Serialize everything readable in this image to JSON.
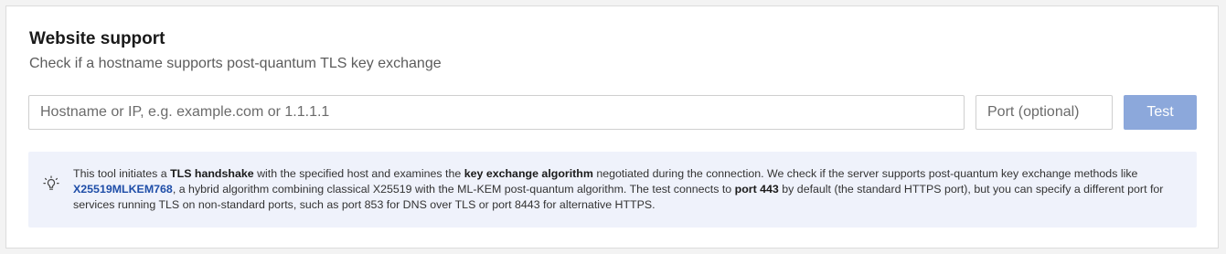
{
  "section": {
    "title": "Website support",
    "subtitle": "Check if a hostname supports post-quantum TLS key exchange"
  },
  "form": {
    "host_placeholder": "Hostname or IP, e.g. example.com or 1.1.1.1",
    "host_value": "",
    "port_placeholder": "Port (optional)",
    "port_value": "",
    "test_label": "Test",
    "test_color": "#8ca8db"
  },
  "info": {
    "icon": "lightbulb-icon",
    "t1": "This tool initiates a ",
    "b1": "TLS handshake",
    "t2": " with the specified host and examines the ",
    "b2": "key exchange algorithm",
    "t3": " negotiated during the connection. We check if the server supports post-quantum key exchange methods like ",
    "link": "X25519MLKEM768",
    "t4": ", a hybrid algorithm combining classical X25519 with the ML-KEM post-quantum algorithm. The test connects to ",
    "b3": "port 443",
    "t5": " by default (the standard HTTPS port), but you can specify a different port for services running TLS on non-standard ports, such as port 853 for DNS over TLS or port 8443 for alternative HTTPS."
  }
}
